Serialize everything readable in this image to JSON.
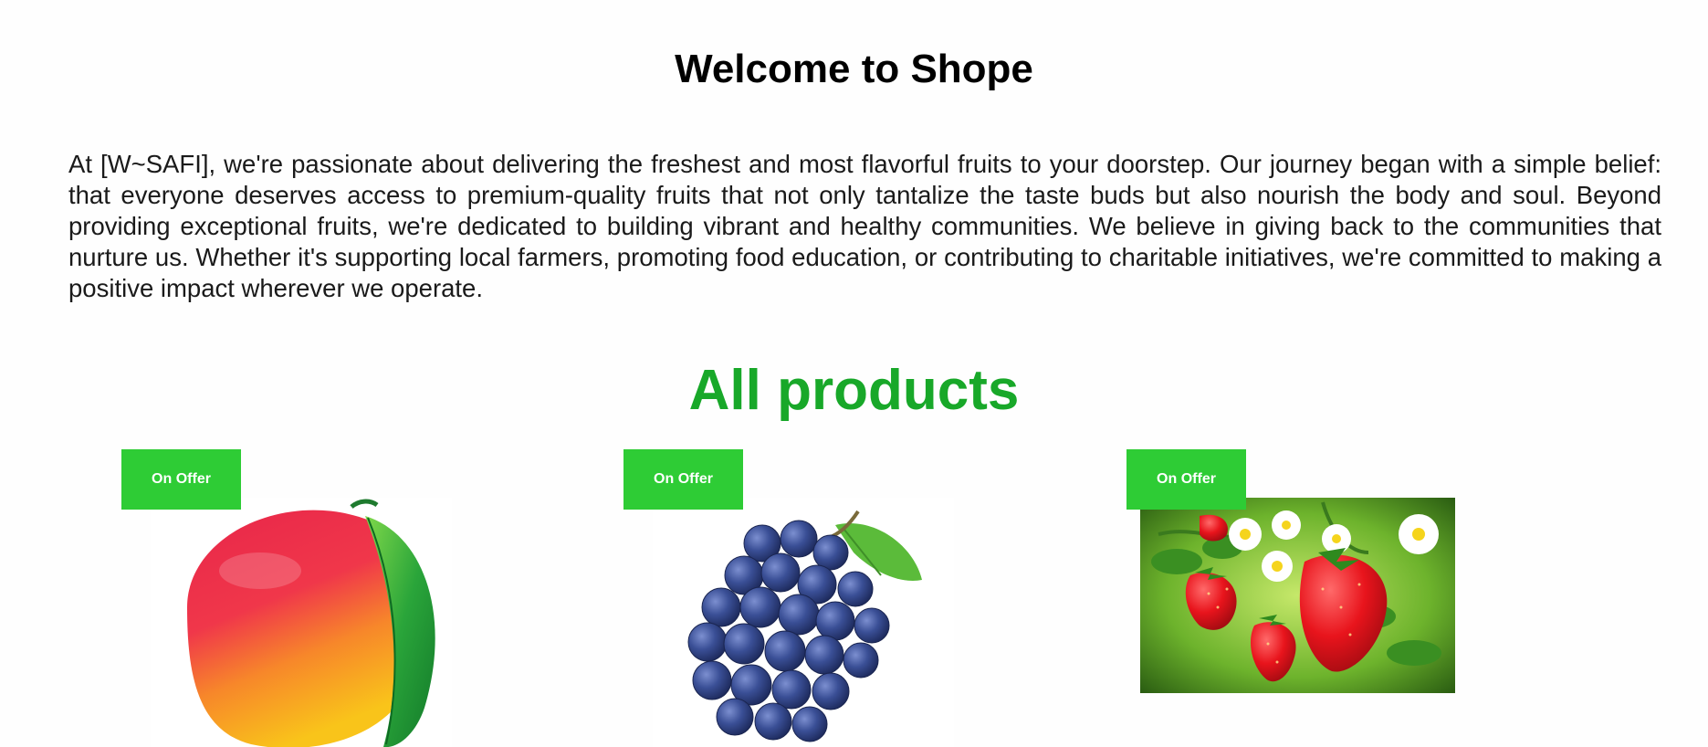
{
  "header": {
    "title": "Welcome to Shope"
  },
  "about": {
    "text": "At [W~SAFI], we're passionate about delivering the freshest and most flavorful fruits to your doorstep. Our journey began with a simple belief: that everyone deserves access to premium-quality fruits that not only tantalize the taste buds but also nourish the body and soul. Beyond providing exceptional fruits, we're dedicated to building vibrant and healthy communities. We believe in giving back to the communities that nurture us. Whether it's supporting local farmers, promoting food education, or contributing to charitable initiatives, we're committed to making a positive impact wherever we operate."
  },
  "products": {
    "title": "All products",
    "items": [
      {
        "badge": "On Offer",
        "image": "mango-image"
      },
      {
        "badge": "On Offer",
        "image": "grapes-image"
      },
      {
        "badge": "On Offer",
        "image": "strawberries-image"
      }
    ]
  },
  "colors": {
    "products_title": "#18a829",
    "badge_bg": "#2ecc35",
    "badge_text": "#ffffff"
  }
}
